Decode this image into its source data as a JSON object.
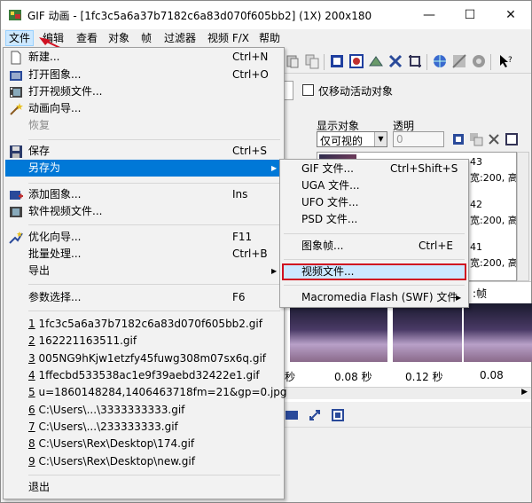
{
  "window": {
    "title": "GIF 动画 - [1fc3c5a6a37b7182c6a83d070f605bb2] (1X) 200x180",
    "controls": {
      "minimize": "—",
      "maximize": "☐",
      "close": "✕"
    }
  },
  "menubar": [
    "文件",
    "编辑",
    "查看",
    "对象",
    "帧",
    "过滤器",
    "视频 F/X",
    "帮助"
  ],
  "file_menu": {
    "new": {
      "label": "新建...",
      "shortcut": "Ctrl+N"
    },
    "open_image": {
      "label": "打开图象...",
      "shortcut": "Ctrl+O"
    },
    "open_video": {
      "label": "打开视频文件..."
    },
    "wizard": {
      "label": "动画向导..."
    },
    "restore": {
      "label": "恢复"
    },
    "save": {
      "label": "保存",
      "shortcut": "Ctrl+S"
    },
    "save_as": {
      "label": "另存为"
    },
    "add_image": {
      "label": "添加图象...",
      "shortcut": "Ins"
    },
    "soft_video": {
      "label": "软件视频文件..."
    },
    "optimize": {
      "label": "优化向导...",
      "shortcut": "F11"
    },
    "batch": {
      "label": "批量处理...",
      "shortcut": "Ctrl+B"
    },
    "export": {
      "label": "导出"
    },
    "preferences": {
      "label": "参数选择...",
      "shortcut": "F6"
    },
    "recent": [
      {
        "num": "1",
        "name": "1fc3c5a6a37b7182c6a83d070f605bb2.gif"
      },
      {
        "num": "2",
        "name": "162221163511.gif"
      },
      {
        "num": "3",
        "name": "005NG9hKjw1etzfy45fuwg308m07sx6q.gif"
      },
      {
        "num": "4",
        "name": "1ffecbd533538ac1e9f39aebd32422e1.gif"
      },
      {
        "num": "5",
        "name": "u=1860148284,1406463718fm=21&gp=0.jpg"
      },
      {
        "num": "6",
        "name": "C:\\Users\\...\\3333333333.gif"
      },
      {
        "num": "7",
        "name": "C:\\Users\\...\\233333333.gif"
      },
      {
        "num": "8",
        "name": "C:\\Users\\Rex\\Desktop\\174.gif"
      },
      {
        "num": "9",
        "name": "C:\\Users\\Rex\\Desktop\\new.gif"
      }
    ],
    "exit": {
      "label": "退出"
    }
  },
  "save_as_menu": {
    "gif": {
      "label": "GIF 文件...",
      "shortcut": "Ctrl+Shift+S"
    },
    "uga": {
      "label": "UGA 文件..."
    },
    "ufo": {
      "label": "UFO 文件..."
    },
    "psd": {
      "label": "PSD 文件..."
    },
    "image_frame": {
      "label": "图象帧...",
      "shortcut": "Ctrl+E"
    },
    "video": {
      "label": "视频文件..."
    },
    "flash": {
      "label": "Macromedia Flash (SWF) 文件"
    }
  },
  "object_panel": {
    "move_active_label": "仅移动活动对象",
    "display_label": "显示对象",
    "display_value": "仅可视的",
    "transparency_label": "透明",
    "transparency_value": "0",
    "rows": [
      {
        "num": "43",
        "info": "宽:200, 高"
      },
      {
        "num": "42",
        "info": "宽:200, 高"
      },
      {
        "num": "41",
        "info": "宽:200, 高"
      }
    ]
  },
  "frames_panel": {
    "label": ":帧",
    "times": [
      "秒",
      "0.08 秒",
      "0.12 秒",
      "0.08"
    ]
  },
  "colors": {
    "accent": "#0078d7",
    "hover": "#cce8ff",
    "annotation": "#d01020"
  }
}
